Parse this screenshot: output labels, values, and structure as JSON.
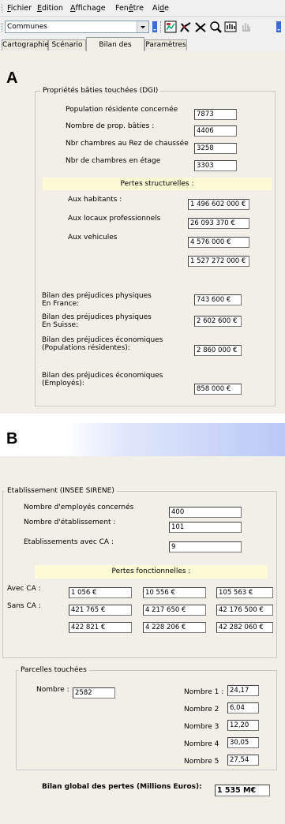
{
  "menu": {
    "items": [
      {
        "accel": "F",
        "rest": "ichier"
      },
      {
        "accel": "E",
        "rest": "dition"
      },
      {
        "accel": "A",
        "rest": "ffichage"
      },
      {
        "pre": "Fen",
        "accel": "ê",
        "rest": "tre"
      },
      {
        "pre": "Ai",
        "accel": "d",
        "rest": "e"
      }
    ]
  },
  "toolbar": {
    "combo_value": "Communes",
    "icons": [
      "map-overview-icon",
      "zoom-in-icon",
      "zoom-out-icon",
      "zoom-window-icon",
      "pan-hand-icon",
      "pan-hand-disabled-icon"
    ]
  },
  "tabs": [
    "Cartographie",
    "Scénario",
    "Bilan des pertes",
    "Paramètres"
  ],
  "panel_a": {
    "marker": "A",
    "group_title": "Propriétés bâties touchées (DGI)",
    "rows": [
      {
        "label": "Population résidente concernée",
        "value": "7873"
      },
      {
        "label": "Nombre de prop. bâties :",
        "value": "4406"
      },
      {
        "label": "Nbr chambres au Rez de chaussée",
        "value": "3258"
      },
      {
        "label": "Nbr de chambres en étage",
        "value": "3303"
      }
    ],
    "pertes_title": "Pertes structurelles :",
    "pertes": [
      {
        "label": "Aux habitants :",
        "value": "1 496 602 000 €"
      },
      {
        "label": "Aux locaux professionnels",
        "value": "26 093 370 €"
      },
      {
        "label": "Aux vehicules",
        "value": "4 576 000 €"
      }
    ],
    "pertes_total": "1 527 272 000 €",
    "bilans": [
      {
        "label": "Bilan des préjudices physiques En France:",
        "value": "743 600 €"
      },
      {
        "label": "Bilan des préjudices physiques En Suisse:",
        "value": "2 602 600 €"
      },
      {
        "label": "Bilan des préjudices économiques (Populations résidentes):",
        "value": "2 860 000 €"
      },
      {
        "label": "Bilan des préjudices économiques (Employés):",
        "value": "858 000 €"
      }
    ]
  },
  "panel_b": {
    "marker": "B",
    "etab_title": "Etablissement (INSEE SIRENE)",
    "etab_rows": [
      {
        "label": "Nombre d'employés concernés",
        "value": "400"
      },
      {
        "label": "Nombre d'établissement :",
        "value": "101"
      },
      {
        "label": "Etablissements avec CA :",
        "value": "9"
      }
    ],
    "pertes_title": "Pertes fonctionnelles :",
    "avec_label": "Avec CA :",
    "sans_label": "Sans CA :",
    "avec": [
      "1 056 €",
      "10 556 €",
      "105 563 €"
    ],
    "sans": [
      "421 765 €",
      "4 217 650 €",
      "42 176 500 €"
    ],
    "totals": [
      "422 821 €",
      "4 228 206 €",
      "42 282 060 €"
    ],
    "parcelles_title": "Parcelles touchées",
    "nombre_label": "Nombre :",
    "nombre_value": "2582",
    "parcelles": [
      {
        "label": "Nombre 1 :",
        "value": "24,17"
      },
      {
        "label": "Nombre 2",
        "value": "6,04"
      },
      {
        "label": "Nombre 3",
        "value": "12,20"
      },
      {
        "label": "Nombre 4",
        "value": "30,05"
      },
      {
        "label": "Nombre 5",
        "value": "27,54"
      }
    ],
    "global_label": "Bilan global des pertes (Millions Euros):",
    "global_value": "1 535 M€"
  }
}
